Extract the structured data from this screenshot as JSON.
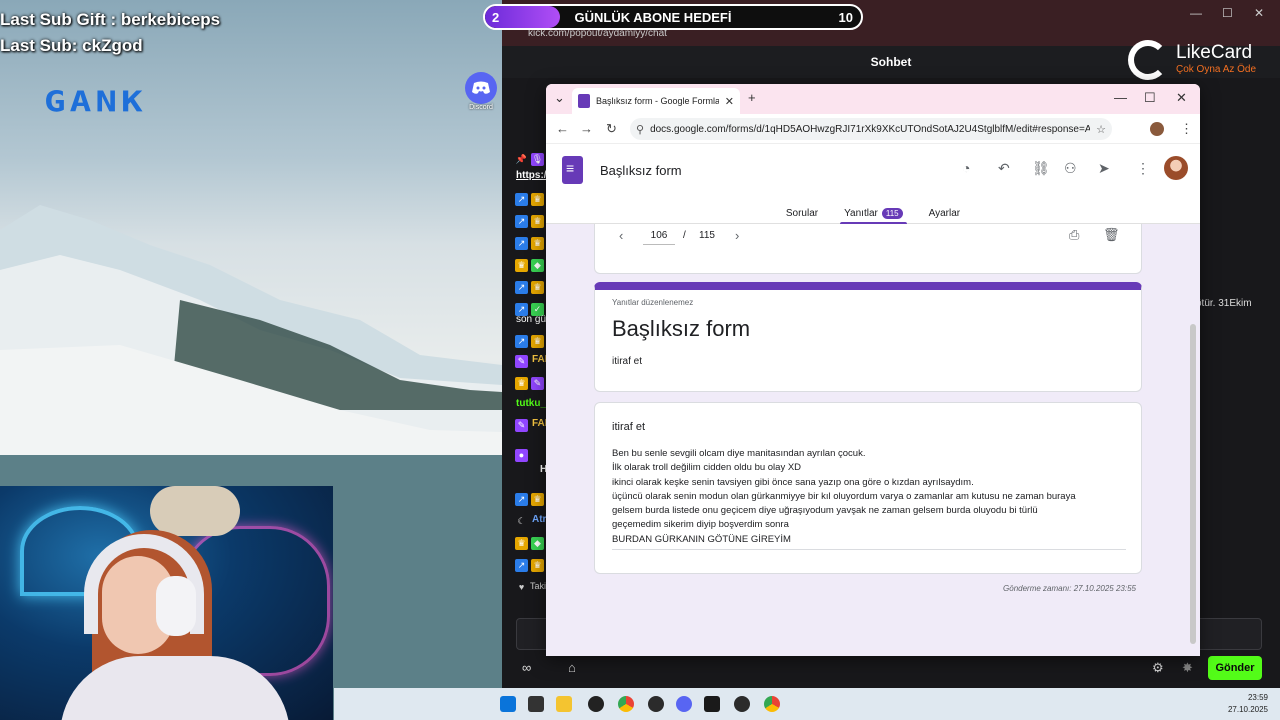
{
  "stream": {
    "last_sub_gift": "Last Sub Gift : berkebiceps",
    "last_sub": "Last Sub: ckZgod",
    "logo_text": "GANK",
    "discord_label": "Discord",
    "discord_icon": "discord-icon"
  },
  "goal": {
    "current": "2",
    "title": "GÜNLÜK ABONE HEDEFİ",
    "target": "10",
    "progress": 0.2
  },
  "kick": {
    "url": "kick.com/popout/aydamiyy/chat",
    "header": "Sohbet",
    "send_label": "Gönder",
    "sponsor_name": "LikeCard",
    "sponsor_tagline": "Çok Oyna  Az Öde",
    "right_text": "ötür. 31Ekim",
    "chat_names": [
      "https:/",
      "son gü",
      "FAI",
      "tutku_",
      "FAI",
      "H",
      "Atr",
      "Taki"
    ]
  },
  "browser": {
    "tab_title": "Başlıksız form - Google Formlar",
    "url": "docs.google.com/forms/d/1qHD5AOHwzgRJI71rXk9XKcUTOndSotAJ2U4StglblfM/edit#response=A..."
  },
  "forms": {
    "doc_title": "Başlıksız form",
    "tabs": {
      "questions": "Sorular",
      "responses": "Yanıtlar",
      "responses_count": "115",
      "settings": "Ayarlar"
    },
    "pager": {
      "current": "106",
      "separator": "/",
      "total": "115"
    },
    "title_card": {
      "note": "Yanıtlar düzenlenemez",
      "title": "Başlıksız form",
      "description": "itiraf et"
    },
    "answer_card": {
      "question": "itiraf et",
      "answer_lines": [
        "Ben bu senle sevgili olcam diye manitasından ayrılan çocuk.",
        "İlk olarak troll değilim cidden oldu bu olay XD",
        "ikinci olarak keşke senin tavsiyen gibi önce sana yazıp ona göre o kızdan ayrılsaydım.",
        "üçüncü olarak senin modun olan gürkanmiyye bir kıl oluyordum varya o zamanlar am kutusu ne zaman buraya",
        "gelsem burda listede onu geçicem diye uğraşıyodum yavşak ne zaman gelsem burda oluyodu bi türlü",
        "geçemedim sikerim diyip boşverdim sonra",
        "BURDAN GÜRKANIN GÖTÜNE GİREYİM"
      ]
    },
    "submitted": "Gönderme zamanı: 27.10.2025 23:55"
  },
  "taskbar": {
    "time": "23:59",
    "date": "27.10.2025"
  },
  "colors": {
    "forms_purple": "#673ab7",
    "kick_green": "#53fc18",
    "forms_bg": "#f0ebf8"
  }
}
